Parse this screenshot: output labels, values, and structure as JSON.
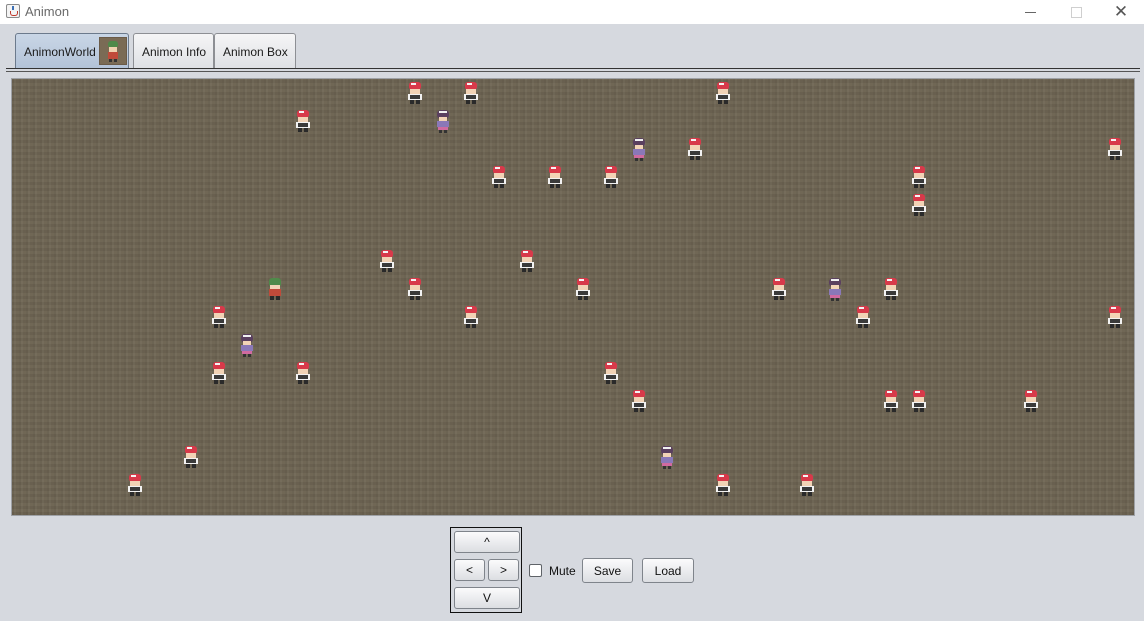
{
  "window": {
    "title": "Animon",
    "minimize_icon": "minimize-icon",
    "maximize_icon": "maximize-icon",
    "close_glyph": "✕"
  },
  "tabs": [
    {
      "label": "AnimonWorld",
      "active": true,
      "icon": "trainer-thumbnail"
    },
    {
      "label": "Animon Info",
      "active": false
    },
    {
      "label": "Animon Box",
      "active": false
    }
  ],
  "world": {
    "background": "#6f6654",
    "player": {
      "col": 7,
      "row": 7,
      "kind": "player"
    },
    "trainers": [
      {
        "col": 12,
        "row": 0,
        "kind": "red"
      },
      {
        "col": 14,
        "row": 0,
        "kind": "red"
      },
      {
        "col": 23,
        "row": 0,
        "kind": "red"
      },
      {
        "col": 8,
        "row": 1,
        "kind": "red"
      },
      {
        "col": 13,
        "row": 1,
        "kind": "girl"
      },
      {
        "col": 20,
        "row": 2,
        "kind": "girl"
      },
      {
        "col": 22,
        "row": 2,
        "kind": "red"
      },
      {
        "col": 37,
        "row": 2,
        "kind": "red"
      },
      {
        "col": 39,
        "row": 2,
        "kind": "girl"
      },
      {
        "col": 15,
        "row": 3,
        "kind": "red"
      },
      {
        "col": 17,
        "row": 3,
        "kind": "red"
      },
      {
        "col": 19,
        "row": 3,
        "kind": "red"
      },
      {
        "col": 30,
        "row": 3,
        "kind": "red"
      },
      {
        "col": 30,
        "row": 4,
        "kind": "red"
      },
      {
        "col": 11,
        "row": 6,
        "kind": "red"
      },
      {
        "col": 16,
        "row": 6,
        "kind": "red"
      },
      {
        "col": 12,
        "row": 7,
        "kind": "red"
      },
      {
        "col": 18,
        "row": 7,
        "kind": "red"
      },
      {
        "col": 25,
        "row": 7,
        "kind": "red"
      },
      {
        "col": 27,
        "row": 7,
        "kind": "girl"
      },
      {
        "col": 29,
        "row": 7,
        "kind": "red"
      },
      {
        "col": 5,
        "row": 8,
        "kind": "red"
      },
      {
        "col": 14,
        "row": 8,
        "kind": "red"
      },
      {
        "col": 28,
        "row": 8,
        "kind": "red"
      },
      {
        "col": 37,
        "row": 8,
        "kind": "red"
      },
      {
        "col": 38,
        "row": 8,
        "kind": "red"
      },
      {
        "col": 39,
        "row": 8,
        "kind": "red"
      },
      {
        "col": 6,
        "row": 9,
        "kind": "girl"
      },
      {
        "col": 39,
        "row": 9,
        "kind": "red"
      },
      {
        "col": 5,
        "row": 10,
        "kind": "red"
      },
      {
        "col": 8,
        "row": 10,
        "kind": "red"
      },
      {
        "col": 19,
        "row": 10,
        "kind": "red"
      },
      {
        "col": 20,
        "row": 11,
        "kind": "red"
      },
      {
        "col": 29,
        "row": 11,
        "kind": "red"
      },
      {
        "col": 30,
        "row": 11,
        "kind": "red"
      },
      {
        "col": 34,
        "row": 11,
        "kind": "red"
      },
      {
        "col": 38,
        "row": 12,
        "kind": "girl"
      },
      {
        "col": 4,
        "row": 13,
        "kind": "red"
      },
      {
        "col": 21,
        "row": 13,
        "kind": "girl"
      },
      {
        "col": 2,
        "row": 14,
        "kind": "red"
      },
      {
        "col": 23,
        "row": 14,
        "kind": "red"
      },
      {
        "col": 26,
        "row": 14,
        "kind": "red"
      }
    ]
  },
  "controls": {
    "up_label": "^",
    "left_label": "<",
    "right_label": ">",
    "down_label": "V",
    "mute_label": "Mute",
    "mute_checked": false,
    "save_label": "Save",
    "load_label": "Load"
  }
}
